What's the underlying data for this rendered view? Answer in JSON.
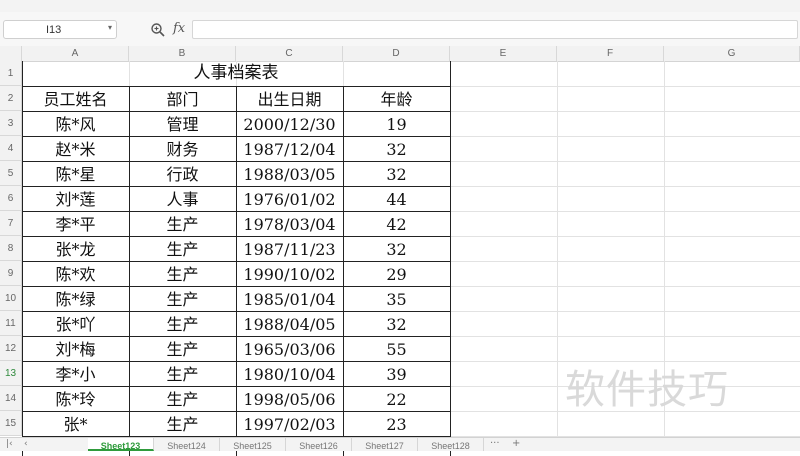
{
  "formula_bar": {
    "name_box_value": "I13",
    "fx_label": "fx",
    "formula_value": ""
  },
  "columns": [
    "A",
    "B",
    "C",
    "D",
    "E",
    "F",
    "G"
  ],
  "rows": [
    "1",
    "2",
    "3",
    "4",
    "5",
    "6",
    "7",
    "8",
    "9",
    "10",
    "11",
    "12",
    "13",
    "14",
    "15"
  ],
  "active_row": "13",
  "table": {
    "title": "人事档案表",
    "headers": [
      "员工姓名",
      "部门",
      "出生日期",
      "年龄"
    ],
    "records": [
      [
        "陈*风",
        "管理",
        "2000/12/30",
        "19"
      ],
      [
        "赵*米",
        "财务",
        "1987/12/04",
        "32"
      ],
      [
        "陈*星",
        "行政",
        "1988/03/05",
        "32"
      ],
      [
        "刘*莲",
        "人事",
        "1976/01/02",
        "44"
      ],
      [
        "李*平",
        "生产",
        "1978/03/04",
        "42"
      ],
      [
        "张*龙",
        "生产",
        "1987/11/23",
        "32"
      ],
      [
        "陈*欢",
        "生产",
        "1990/10/02",
        "29"
      ],
      [
        "陈*绿",
        "生产",
        "1985/01/04",
        "35"
      ],
      [
        "张*吖",
        "生产",
        "1988/04/05",
        "32"
      ],
      [
        "刘*梅",
        "生产",
        "1965/03/06",
        "55"
      ],
      [
        "李*小",
        "生产",
        "1980/10/04",
        "39"
      ],
      [
        "陈*玲",
        "生产",
        "1998/05/06",
        "22"
      ],
      [
        "张*",
        "生产",
        "1997/02/03",
        "23"
      ]
    ]
  },
  "sheet_tabs": [
    "Sheet123",
    "Sheet124",
    "Sheet125",
    "Sheet126",
    "Sheet127",
    "Sheet128"
  ],
  "active_tab": "Sheet123",
  "tab_more": "···",
  "add_tab": "+",
  "watermark": "软件技巧",
  "icons": {
    "zoom": "magnifier-plus-icon",
    "dropdown": "chevron-down-icon",
    "nav_first": "first-sheet-icon",
    "nav_prev": "prev-sheet-icon"
  },
  "colors": {
    "accent": "#2f9b3c",
    "header_bg": "#f2f2f2",
    "grid": "#e2e2e2",
    "table_border": "#222222"
  }
}
